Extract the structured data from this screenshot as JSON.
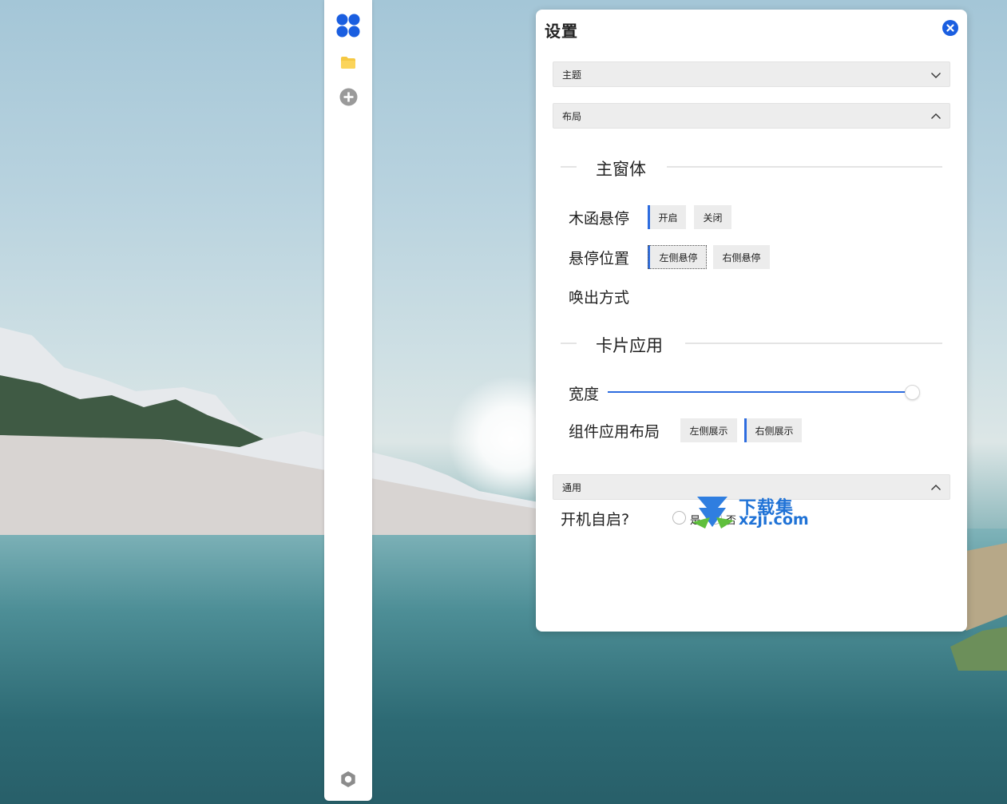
{
  "settings": {
    "title": "设置",
    "sections": {
      "theme": {
        "label": "主题",
        "expanded": false
      },
      "layout": {
        "label": "布局",
        "expanded": true
      },
      "general": {
        "label": "通用",
        "expanded": true
      }
    },
    "main_window": {
      "heading": "主窗体",
      "hover": {
        "label": "木函悬停",
        "options": [
          "开启",
          "关闭"
        ],
        "selected": "开启"
      },
      "hover_position": {
        "label": "悬停位置",
        "options": [
          "左侧悬停",
          "右侧悬停"
        ],
        "selected": "左侧悬停"
      },
      "wake_method": {
        "label": "唤出方式"
      }
    },
    "card_apps": {
      "heading": "卡片应用",
      "width": {
        "label": "宽度",
        "value_fraction": 0.98
      },
      "widget_layout": {
        "label": "组件应用布局",
        "options": [
          "左侧展示",
          "右侧展示"
        ],
        "selected": "右侧展示"
      }
    },
    "general": {
      "autostart": {
        "label": "开机自启?",
        "options": [
          "是",
          "否"
        ]
      }
    }
  },
  "dock": {
    "icons": [
      "apps-grid-icon",
      "folder-icon",
      "add-icon",
      "settings-icon"
    ]
  },
  "watermark": {
    "line1": "下载集",
    "line2": "xzji.com"
  },
  "colors": {
    "accent": "#2d6cdf",
    "close": "#1a5ee0",
    "folder": "#f5c842",
    "apps": "#1a5ee0"
  }
}
